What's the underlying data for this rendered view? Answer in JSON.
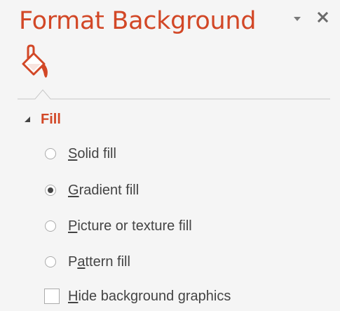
{
  "pane": {
    "title": "Format Background",
    "accent_color": "#d24726",
    "dropdown_icon": "caret-down-icon",
    "close_icon": "close-icon",
    "tab_icon": "paint-bucket-icon"
  },
  "fill_section": {
    "title": "Fill",
    "expanded": true,
    "options": [
      {
        "label_pre": "",
        "label_key": "S",
        "label_post": "olid fill",
        "type": "radio",
        "checked": false
      },
      {
        "label_pre": "",
        "label_key": "G",
        "label_post": "radient fill",
        "type": "radio",
        "checked": true
      },
      {
        "label_pre": "",
        "label_key": "P",
        "label_post": "icture or texture fill",
        "type": "radio",
        "checked": false
      },
      {
        "label_pre": "P",
        "label_key": "a",
        "label_post": "ttern fill",
        "type": "radio",
        "checked": false
      },
      {
        "label_pre": "",
        "label_key": "H",
        "label_post": "ide background graphics",
        "type": "checkbox",
        "checked": false
      }
    ]
  }
}
